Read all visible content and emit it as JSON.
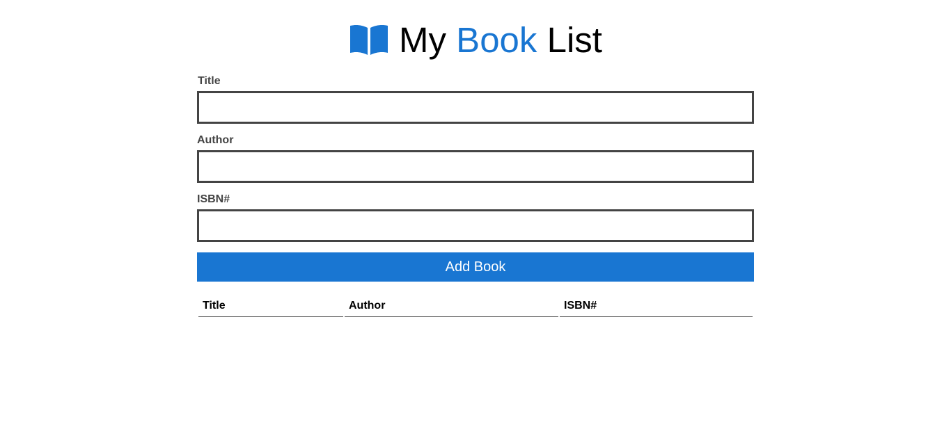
{
  "header": {
    "title_prefix": "My ",
    "title_accent": "Book",
    "title_suffix": " List",
    "icon": "book-open-icon",
    "accent_color": "#1976d2"
  },
  "form": {
    "title_label": "Title",
    "title_value": "",
    "author_label": "Author",
    "author_value": "",
    "isbn_label": "ISBN#",
    "isbn_value": "",
    "submit_label": "Add Book"
  },
  "table": {
    "columns": [
      "Title",
      "Author",
      "ISBN#"
    ],
    "rows": []
  }
}
